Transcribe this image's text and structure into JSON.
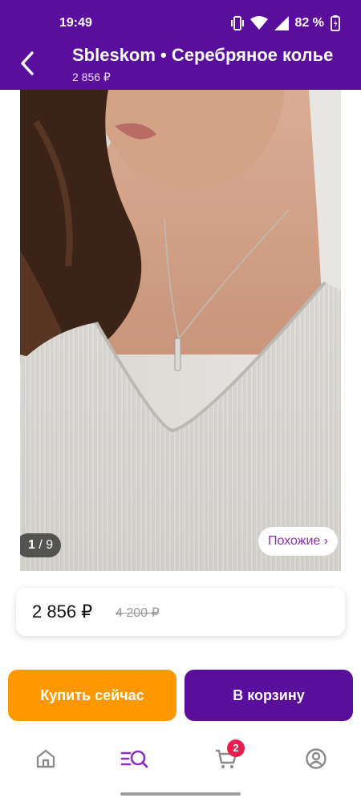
{
  "status_bar": {
    "time": "19:49",
    "battery": "82 %",
    "icons": [
      "vibrate-icon",
      "wifi-icon",
      "signal-icon",
      "battery-icon"
    ]
  },
  "header": {
    "title": "Sbleskom • Серебряное колье",
    "subtitle": "2 856 ₽",
    "back_icon": "arrow-left-icon"
  },
  "gallery": {
    "current": "1",
    "separator": "/",
    "total": "9",
    "similar_label": "Похожие ›"
  },
  "price": {
    "current": "2 856 ₽",
    "old": "4 200 ₽"
  },
  "actions": {
    "buy_now": "Купить сейчас",
    "add_to_cart": "В корзину"
  },
  "bottom_nav": {
    "items": [
      {
        "name": "home-icon",
        "active": false
      },
      {
        "name": "catalog-search-icon",
        "active": true
      },
      {
        "name": "cart-icon",
        "active": false
      },
      {
        "name": "profile-icon",
        "active": false
      }
    ],
    "cart_badge": "2"
  },
  "colors": {
    "brand_purple": "#5a0f9c",
    "orange": "#ff9800",
    "badge_red": "#e91e4f",
    "accent_violet": "#8a2fc0"
  }
}
